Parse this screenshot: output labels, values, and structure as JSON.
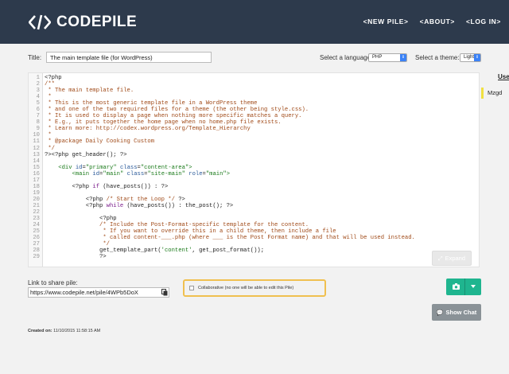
{
  "header": {
    "logo_text": "CODEPILE",
    "nav": [
      {
        "label": "<NEW PILE>"
      },
      {
        "label": "<ABOUT>"
      },
      {
        "label": "<LOG IN>"
      }
    ]
  },
  "form": {
    "title_label": "Title:",
    "title_value": "The main template file (for WordPress)",
    "language_label": "Select a language:",
    "language_value": "PHP",
    "theme_label": "Select a theme:",
    "theme_value": "Light"
  },
  "editor": {
    "lines": [
      {
        "n": "1",
        "segments": [
          [
            "dk",
            "<?php"
          ]
        ]
      },
      {
        "n": "2",
        "segments": [
          [
            "cm",
            "/**"
          ]
        ]
      },
      {
        "n": "3",
        "segments": [
          [
            "cm",
            " * The main template file."
          ]
        ]
      },
      {
        "n": "4",
        "segments": [
          [
            "cm",
            " *"
          ]
        ]
      },
      {
        "n": "5",
        "segments": [
          [
            "cm",
            " * This is the most generic template file in a WordPress theme"
          ]
        ]
      },
      {
        "n": "6",
        "segments": [
          [
            "cm",
            " * and one of the two required files for a theme (the other being style.css)."
          ]
        ]
      },
      {
        "n": "7",
        "segments": [
          [
            "cm",
            " * It is used to display a page when nothing more specific matches a query."
          ]
        ]
      },
      {
        "n": "8",
        "segments": [
          [
            "cm",
            " * E.g., it puts together the home page when no home.php file exists."
          ]
        ]
      },
      {
        "n": "9",
        "segments": [
          [
            "cm",
            " * Learn more: http://codex.wordpress.org/Template_Hierarchy"
          ]
        ]
      },
      {
        "n": "10",
        "segments": [
          [
            "cm",
            " *"
          ]
        ]
      },
      {
        "n": "11",
        "segments": [
          [
            "cm",
            " * @package Daily Cooking Custom"
          ]
        ]
      },
      {
        "n": "12",
        "segments": [
          [
            "cm",
            " */"
          ]
        ]
      },
      {
        "n": "13",
        "segments": [
          [
            "dk",
            "?><?php get_header(); ?>"
          ]
        ]
      },
      {
        "n": "14",
        "segments": [
          [
            "dk",
            ""
          ]
        ]
      },
      {
        "n": "15",
        "segments": [
          [
            "dk",
            "    "
          ],
          [
            "tg",
            "<div "
          ],
          [
            "at",
            "id"
          ],
          [
            "dk",
            "="
          ],
          [
            "st",
            "\"primary\" "
          ],
          [
            "at",
            "class"
          ],
          [
            "dk",
            "="
          ],
          [
            "st",
            "\"content-area\""
          ],
          [
            "tg",
            ">"
          ]
        ]
      },
      {
        "n": "16",
        "segments": [
          [
            "dk",
            "        "
          ],
          [
            "tg",
            "<main "
          ],
          [
            "at",
            "id"
          ],
          [
            "dk",
            "="
          ],
          [
            "st",
            "\"main\" "
          ],
          [
            "at",
            "class"
          ],
          [
            "dk",
            "="
          ],
          [
            "st",
            "\"site-main\" "
          ],
          [
            "at",
            "role"
          ],
          [
            "dk",
            "="
          ],
          [
            "st",
            "\"main\""
          ],
          [
            "tg",
            ">"
          ]
        ]
      },
      {
        "n": "17",
        "segments": [
          [
            "dk",
            ""
          ]
        ]
      },
      {
        "n": "18",
        "segments": [
          [
            "dk",
            "        <?php "
          ],
          [
            "kw",
            "if"
          ],
          [
            "dk",
            " (have_posts()) : ?>"
          ]
        ]
      },
      {
        "n": "19",
        "segments": [
          [
            "dk",
            ""
          ]
        ]
      },
      {
        "n": "20",
        "segments": [
          [
            "dk",
            "            <?php "
          ],
          [
            "cm",
            "/* Start the Loop */"
          ],
          [
            "dk",
            " ?>"
          ]
        ]
      },
      {
        "n": "21",
        "segments": [
          [
            "dk",
            "            <?php "
          ],
          [
            "kw",
            "while"
          ],
          [
            "dk",
            " (have_posts()) : the_post(); ?>"
          ]
        ]
      },
      {
        "n": "22",
        "segments": [
          [
            "dk",
            ""
          ]
        ]
      },
      {
        "n": "23",
        "segments": [
          [
            "dk",
            "                <?php"
          ]
        ]
      },
      {
        "n": "24",
        "segments": [
          [
            "cm",
            "                /* Include the Post-Format-specific template for the content."
          ]
        ]
      },
      {
        "n": "25",
        "segments": [
          [
            "cm",
            "                 * If you want to override this in a child theme, then include a file"
          ]
        ]
      },
      {
        "n": "26",
        "segments": [
          [
            "cm",
            "                 * called content-___.php (where ___ is the Post Format name) and that will be used instead."
          ]
        ]
      },
      {
        "n": "27",
        "segments": [
          [
            "cm",
            "                 */"
          ]
        ]
      },
      {
        "n": "28",
        "segments": [
          [
            "dk",
            "                get_template_part("
          ],
          [
            "st",
            "'content'"
          ],
          [
            "dk",
            ", get_post_format());"
          ]
        ]
      },
      {
        "n": "29",
        "segments": [
          [
            "dk",
            "                ?>"
          ]
        ]
      }
    ],
    "expand_label": "Expand"
  },
  "sidebar": {
    "users_label": "Use",
    "user_name": "Mzgd"
  },
  "share": {
    "label": "Link to share pile:",
    "url": "https://www.codepile.net/pile/4WPb5DoX",
    "collab_label": "Collaborative (no one will be able to edit this Pile)"
  },
  "actions": {
    "show_chat_label": "Show Chat"
  },
  "meta": {
    "created_label": "Created on:",
    "created_value": "11/10/2015 11:58:15 AM"
  },
  "colors": {
    "header_bg": "#2d3a4c",
    "accent_green": "#1fb58f",
    "collab_border": "#f0c050",
    "chat_button": "#8a9297"
  }
}
